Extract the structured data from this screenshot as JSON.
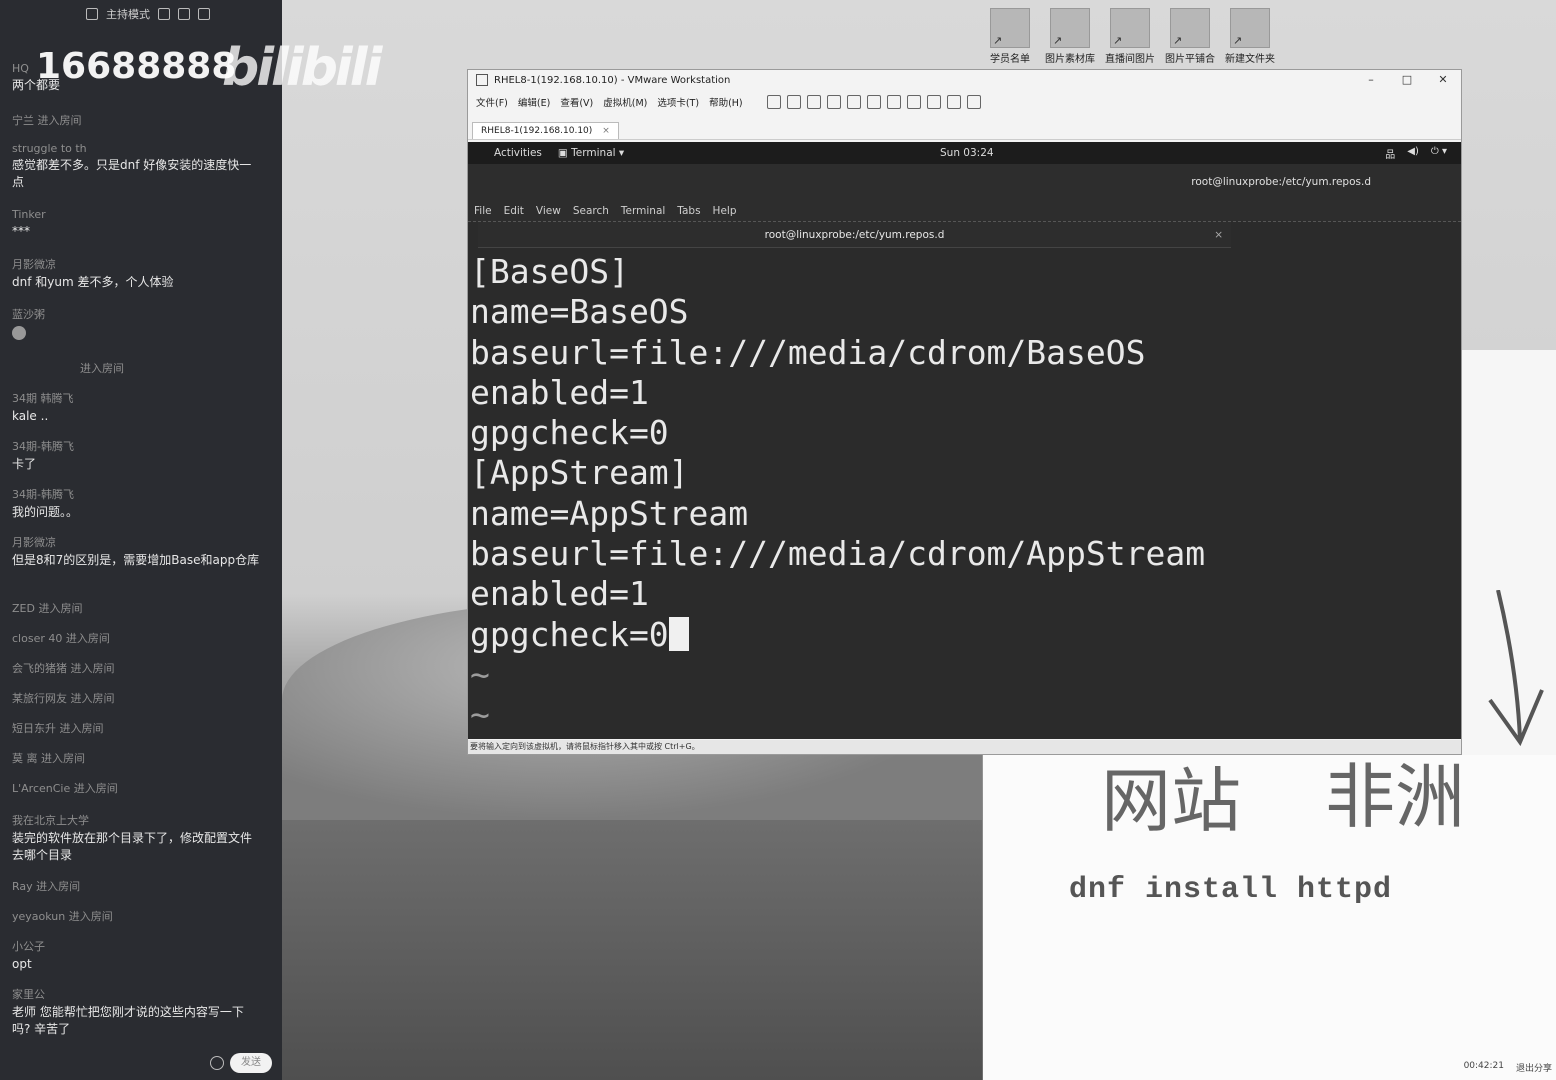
{
  "sidebar": {
    "mode_label": "主持模式",
    "watermark_number": "16688888",
    "watermark_logo": "bilibili",
    "messages": [
      {
        "user": "HQ",
        "text": "两个都要"
      },
      {
        "user": "",
        "text": "宁兰 进入房间"
      },
      {
        "user": "struggle to th",
        "text": "感觉都差不多。只是dnf 好像安装的速度快一点"
      },
      {
        "user": "Tinker",
        "text": "***"
      },
      {
        "user": "月影微凉",
        "text": "dnf 和yum 差不多，个人体验"
      },
      {
        "user": "蓝沙粥",
        "text": ""
      },
      {
        "user": "",
        "text": "进入房间"
      },
      {
        "user": "34期 韩腾飞",
        "text": "kale .."
      },
      {
        "user": "34期-韩腾飞",
        "text": "卡了"
      },
      {
        "user": "34期-韩腾飞",
        "text": "我的问题。。"
      },
      {
        "user": "月影微凉",
        "text": "但是8和7的区别是，需要增加Base和app仓库"
      },
      {
        "user": "",
        "text": "ZED 进入房间"
      },
      {
        "user": "",
        "text": "closer 40 进入房间"
      },
      {
        "user": "",
        "text": "会飞的猪猪 进入房间"
      },
      {
        "user": "",
        "text": "某旅行网友 进入房间"
      },
      {
        "user": "",
        "text": "短日东升 进入房间"
      },
      {
        "user": "",
        "text": "莫 离 进入房间"
      },
      {
        "user": "",
        "text": "L'ArcenCie 进入房间"
      },
      {
        "user": "我在北京上大学",
        "text": "装完的软件放在那个目录下了，修改配置文件去哪个目录"
      },
      {
        "user": "",
        "text": "Ray 进入房间"
      },
      {
        "user": "",
        "text": "yeyaokun 进入房间"
      },
      {
        "user": "小公子",
        "text": "opt"
      },
      {
        "user": "家里公",
        "text": "老师 您能帮忙把您刚才说的这些内容写一下吗?  辛苦了"
      }
    ],
    "send_label": "发送"
  },
  "desktop_icons": [
    "学员名单",
    "图片素材库",
    "直播间图片",
    "图片平铺合",
    "新建文件夹"
  ],
  "vmware": {
    "title": "RHEL8-1(192.168.10.10) - VMware Workstation",
    "menus": [
      "文件(F)",
      "编辑(E)",
      "查看(V)",
      "虚拟机(M)",
      "选项卡(T)",
      "帮助(H)"
    ],
    "tab": "RHEL8-1(192.168.10.10)",
    "status": "要将输入定向到该虚拟机，请将鼠标指针移入其中或按 Ctrl+G。"
  },
  "gnome": {
    "activities": "Activities",
    "app": "Terminal",
    "clock": "Sun 03:24"
  },
  "terminal": {
    "title": "root@linuxprobe:/etc/yum.repos.d",
    "menus": [
      "File",
      "Edit",
      "View",
      "Search",
      "Terminal",
      "Tabs",
      "Help"
    ],
    "tab_title": "root@linuxprobe:/etc/yum.repos.d",
    "lines": [
      "[BaseOS]",
      "name=BaseOS",
      "baseurl=file:///media/cdrom/BaseOS",
      "enabled=1",
      "gpgcheck=0",
      "[AppStream]",
      "name=AppStream",
      "baseurl=file:///media/cdrom/AppStream",
      "enabled=1",
      "gpgcheck=0",
      "~",
      "~"
    ]
  },
  "board": {
    "handwriting_1": "网站",
    "handwriting_2": "非洲",
    "command": "dnf install httpd",
    "timer": "00:42:21",
    "exit_label": "退出分享"
  }
}
